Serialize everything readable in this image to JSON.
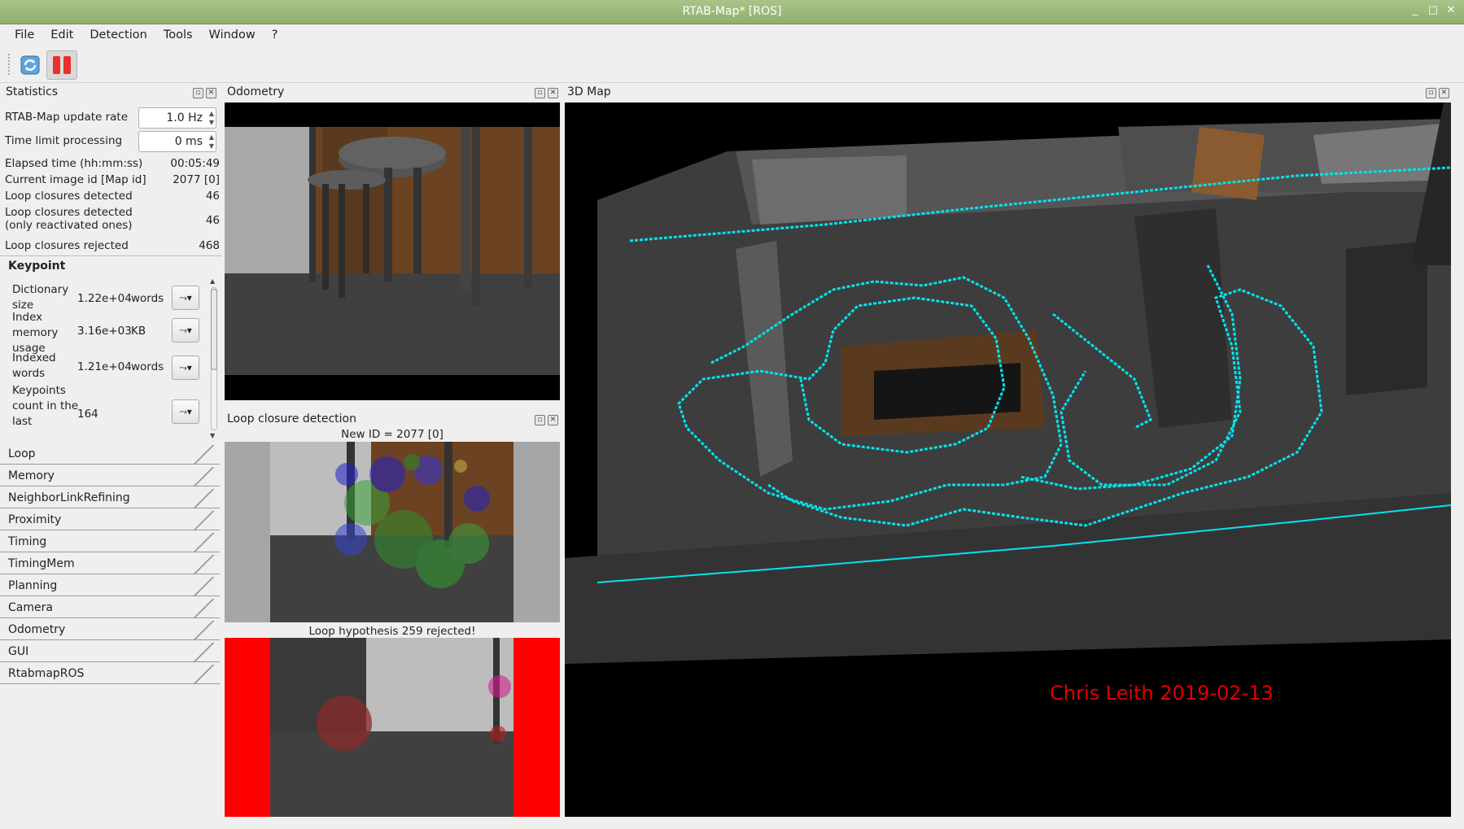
{
  "window": {
    "title": "RTAB-Map* [ROS]",
    "controls": [
      "_",
      "□",
      "✕"
    ]
  },
  "menu": [
    "File",
    "Edit",
    "Detection",
    "Tools",
    "Window",
    "?"
  ],
  "toolbar": {
    "refresh_icon": "refresh-icon",
    "pause_icon": "pause-icon"
  },
  "docks": {
    "statistics": "Statistics",
    "odometry": "Odometry",
    "loop_closure": "Loop closure detection",
    "map3d": "3D Map"
  },
  "stats": {
    "update_rate_label": "RTAB-Map update rate",
    "update_rate_value": "1.0 Hz",
    "time_limit_label": "Time limit processing",
    "time_limit_value": "0 ms",
    "rows": [
      {
        "label": "Elapsed time (hh:mm:ss)",
        "value": "00:05:49"
      },
      {
        "label": "Current image id [Map id]",
        "value": "2077 [0]"
      },
      {
        "label": "Loop closures detected",
        "value": "46"
      },
      {
        "label": "Loop closures detected",
        "label2": "(only reactivated ones)",
        "value": "46"
      },
      {
        "label": "Loop closures rejected",
        "value": "468"
      }
    ],
    "keypoint": {
      "header": "Keypoint",
      "items": [
        {
          "label": "Dictionary size",
          "value": "1.22e+04",
          "unit": "words"
        },
        {
          "label": "Index memory usage",
          "value": "3.16e+03",
          "unit": "KB"
        },
        {
          "label": "Indexed words",
          "value": "1.21e+04",
          "unit": "words"
        },
        {
          "label": "Keypoints count in the last",
          "value": "164",
          "unit": ""
        }
      ]
    },
    "categories": [
      "Loop",
      "Memory",
      "NeighborLinkRefining",
      "Proximity",
      "Timing",
      "TimingMem",
      "Planning",
      "Camera",
      "Odometry",
      "GUI",
      "RtabmapROS"
    ]
  },
  "loop_closure": {
    "new_id": "New ID = 2077 [0]",
    "hypothesis": "Loop hypothesis 259 rejected!"
  },
  "map": {
    "signature": "Chris Leith 2019-02-13",
    "trajectory_color": "#00e5ee",
    "signature_color": "#e00000"
  }
}
